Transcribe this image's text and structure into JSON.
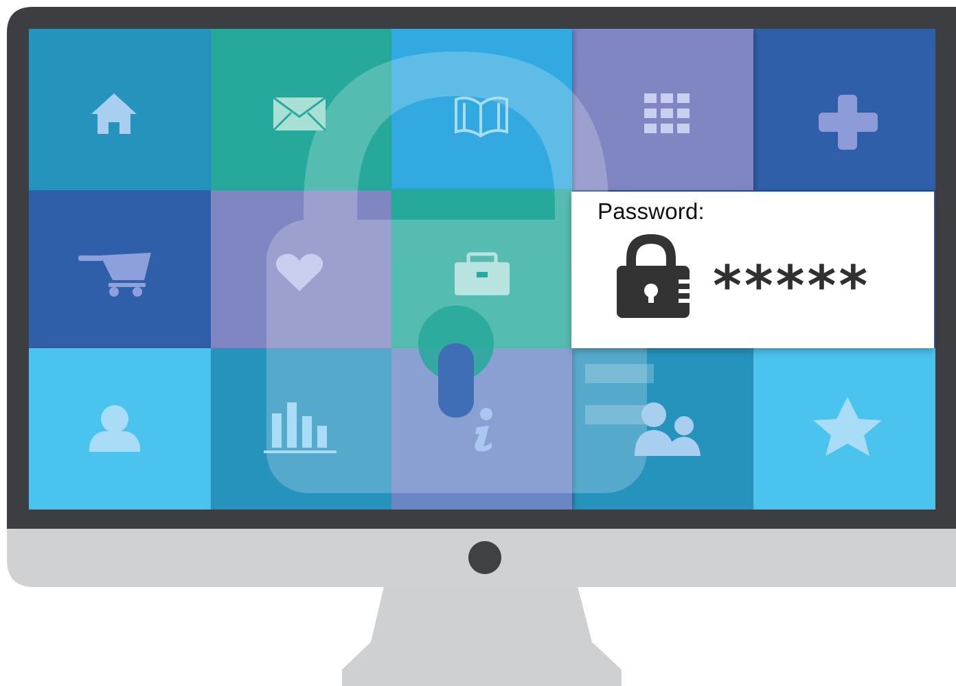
{
  "password_panel": {
    "label": "Password:",
    "masked_value": "*****",
    "lock_icon": "padlock-icon"
  },
  "tiles": [
    {
      "icon": "home-icon",
      "color": "#2693bd"
    },
    {
      "icon": "mail-icon",
      "color": "#27a99b"
    },
    {
      "icon": "book-icon",
      "color": "#33a9e0"
    },
    {
      "icon": "apps-grid-icon",
      "color": "#7f86c2"
    },
    {
      "icon": "plus-icon",
      "color": "#2f5fa8"
    },
    {
      "icon": "cart-icon",
      "color": "#2f5fa8"
    },
    {
      "icon": "heart-icon",
      "color": "#7f86c2"
    },
    {
      "icon": "briefcase-icon",
      "color": "#27a99b"
    },
    {
      "icon": "user-icon",
      "color": "#4cc3ef"
    },
    {
      "icon": "bar-chart-icon",
      "color": "#2693bd"
    },
    {
      "icon": "info-icon",
      "color": "#6a86c7"
    },
    {
      "icon": "group-icon",
      "color": "#2693bd"
    },
    {
      "icon": "star-icon",
      "color": "#4cc3ef"
    }
  ],
  "colors": {
    "bezel": "#3d3e41",
    "chin": "#d0d1d3",
    "stand": "#cfd0d2",
    "camera": "#404145",
    "icon_light": "#a9cff0",
    "padlock_overlay": "#ffffff"
  }
}
